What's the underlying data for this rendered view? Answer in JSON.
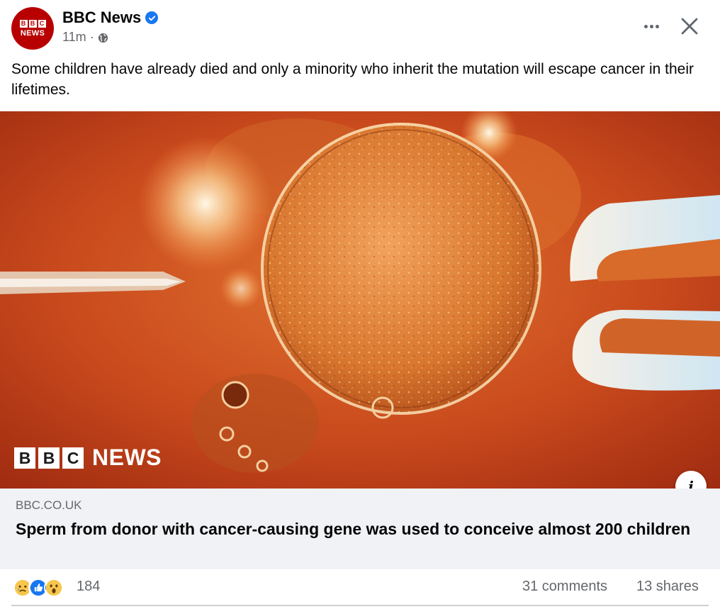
{
  "post": {
    "page_name": "BBC News",
    "avatar": {
      "line1": [
        "B",
        "B",
        "C"
      ],
      "line2": "NEWS"
    },
    "time": "11m",
    "separator": "·",
    "caption": "Some children have already died and only a minority who inherit the mutation will escape cancer in their lifetimes."
  },
  "media": {
    "watermark_blocks": [
      "B",
      "B",
      "C"
    ],
    "watermark_word": "NEWS",
    "info_label": "i"
  },
  "link": {
    "domain": "BBC.CO.UK",
    "headline": "Sperm from donor with cancer-causing gene was used to conceive almost 200 children"
  },
  "stats": {
    "reaction_count": "184",
    "comments": "31 comments",
    "shares": "13 shares",
    "reactions": [
      "sad-icon",
      "like-icon",
      "wow-icon"
    ]
  },
  "colors": {
    "brand_red": "#b80000",
    "facebook_blue": "#1877f2",
    "secondary_text": "#65676b",
    "link_bg": "#f0f2f5"
  }
}
